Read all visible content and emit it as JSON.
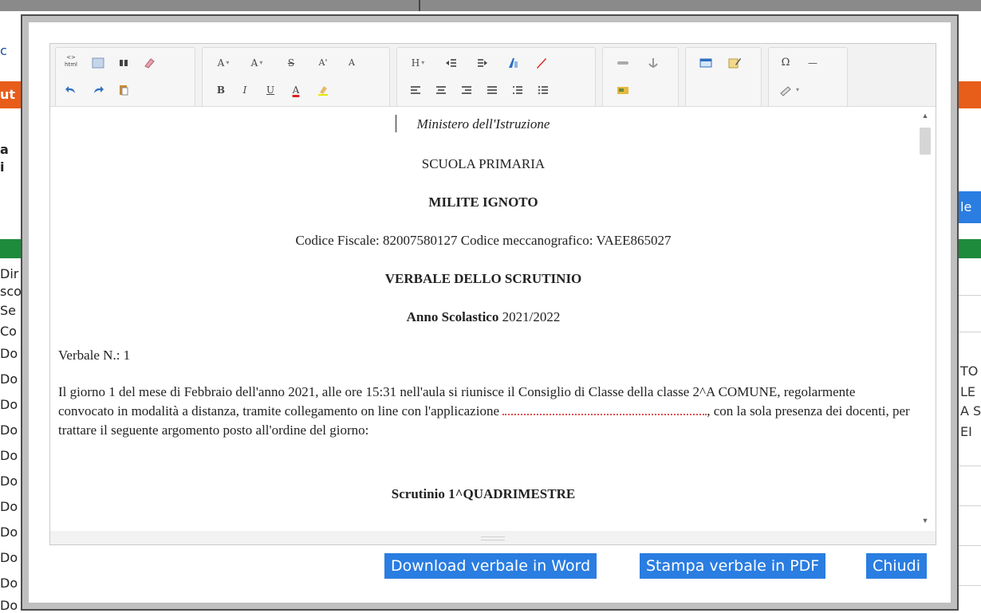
{
  "background": {
    "left_fragments": [
      "c",
      "ut",
      "a",
      "i",
      "Dir",
      "sco",
      "Se",
      "Co",
      "Do",
      "Do",
      "Do",
      "Do",
      "Do",
      "Do",
      "Do",
      "Do",
      "Do",
      "Do",
      "Do"
    ],
    "right_fragments": [
      "le",
      "TO",
      "LE",
      "A S",
      "EI"
    ],
    "colors": {
      "orange_band": "#e85d1a",
      "green_band": "#1e8a3c",
      "modal_frame": "#bfbfbf",
      "button_blue": "#2a7de1"
    }
  },
  "toolbar": {
    "icons": [
      "source-html-icon",
      "preview-icon",
      "find-icon",
      "eraser-icon",
      "undo-icon",
      "redo-icon",
      "paste-icon",
      "font-size-icon",
      "font-family-icon",
      "strikethrough-icon",
      "superscript-icon",
      "subscript-icon",
      "bold-icon",
      "italic-icon",
      "underline-icon",
      "font-color-icon",
      "highlight-icon",
      "heading-icon",
      "indent-icon",
      "outdent-icon",
      "text-direction-icon",
      "pen-icon",
      "align-left-icon",
      "align-center-icon",
      "align-right-icon",
      "justify-icon",
      "ordered-list-icon",
      "unordered-list-icon",
      "link-icon",
      "anchor-icon",
      "image-icon",
      "table-icon",
      "edit-form-icon",
      "special-char-icon",
      "horizontal-rule-icon",
      "styles-icon"
    ],
    "labels": {
      "source": "<> html",
      "font_a": "A",
      "font_a2": "A",
      "strike": "S",
      "sup": "A'",
      "sub": "A",
      "bold": "B",
      "italic": "I",
      "underline": "U",
      "color": "A",
      "heading": "H",
      "omega": "Ω",
      "dash": "—"
    }
  },
  "document": {
    "line1": "Ministero dell'Istruzione",
    "line2": "SCUOLA PRIMARIA",
    "line3": "MILITE IGNOTO",
    "line4": "Codice Fiscale: 82007580127 Codice meccanografico: VAEE865027",
    "line5": "VERBALE DELLO SCRUTINIO",
    "anno_label": "Anno Scolastico",
    "anno_value": " 2021/2022",
    "verbale_n": "Verbale N.: 1",
    "paragraph_part1": "Il giorno 1 del mese di Febbraio dell'anno 2021, alle ore 15:31 nell'aula si riunisce il Consiglio di Classe della classe 2^A COMUNE, regolarmente convocato in modalità a distanza, tramite collegamento on line con l'applicazione",
    "paragraph_part2": ", con la sola presenza dei docenti, per trattare il seguente argomento posto all'ordine del giorno:",
    "scrutinio": "Scrutinio 1^QUADRIMESTRE"
  },
  "buttons": {
    "download_word": "Download verbale in Word",
    "print_pdf": "Stampa verbale in PDF",
    "close": "Chiudi"
  }
}
